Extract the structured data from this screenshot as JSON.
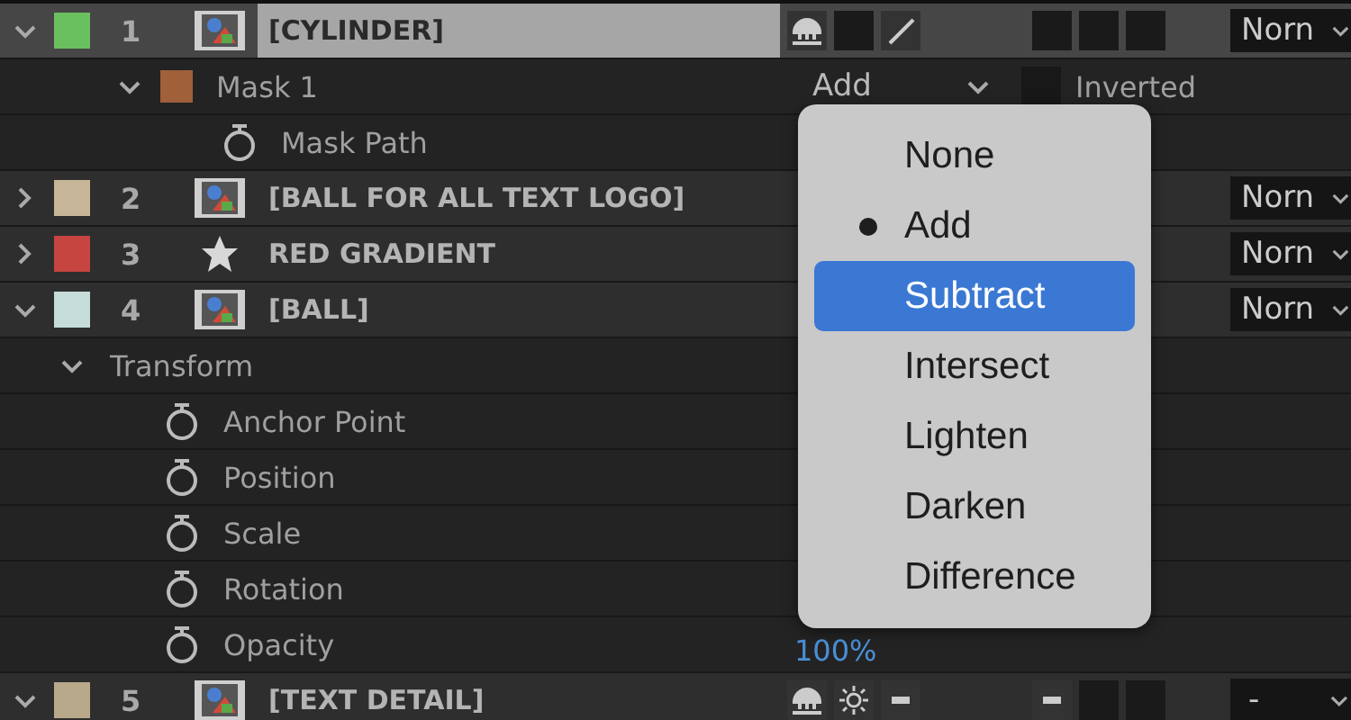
{
  "layers": [
    {
      "number": "1",
      "name": "[CYLINDER]",
      "color": "#6abf5e",
      "kind": "footage",
      "expanded": true,
      "selected": true,
      "switches": [
        {
          "kind": "puppet",
          "on": true
        },
        {
          "kind": "box",
          "on": false
        },
        {
          "kind": "slash",
          "on": true
        }
      ],
      "flags": [
        {
          "kind": "box",
          "on": false
        },
        {
          "kind": "box",
          "on": false
        },
        {
          "kind": "box",
          "on": false
        }
      ],
      "mode": "Norn",
      "children": [
        {
          "kind": "mask",
          "label": "Mask 1",
          "color": "#a0603a",
          "expanded": true,
          "mask_mode": "Add",
          "inverted_label": "Inverted",
          "inverted": false,
          "children": [
            {
              "kind": "property",
              "label": "Mask Path"
            }
          ]
        }
      ]
    },
    {
      "number": "2",
      "name": "[BALL FOR ALL TEXT LOGO]",
      "color": "#c7b798",
      "kind": "footage",
      "expanded": false,
      "selected": false,
      "mode": "Norn"
    },
    {
      "number": "3",
      "name": "RED GRADIENT",
      "color": "#c64541",
      "kind": "shape",
      "expanded": false,
      "selected": false,
      "mode": "Norn"
    },
    {
      "number": "4",
      "name": "[BALL]",
      "color": "#c5dcd9",
      "kind": "footage",
      "expanded": true,
      "selected": false,
      "mode": "Norn",
      "children": [
        {
          "kind": "group",
          "label": "Transform",
          "expanded": true,
          "children": [
            {
              "kind": "property",
              "label": "Anchor Point"
            },
            {
              "kind": "property",
              "label": "Position"
            },
            {
              "kind": "property",
              "label": "Scale"
            },
            {
              "kind": "property",
              "label": "Rotation"
            },
            {
              "kind": "property",
              "label": "Opacity",
              "value": "100%"
            }
          ]
        }
      ]
    },
    {
      "number": "5",
      "name": "[TEXT DETAIL]",
      "color": "#b8a98a",
      "kind": "footage",
      "expanded": true,
      "selected": false,
      "switches": [
        {
          "kind": "puppet",
          "on": true
        },
        {
          "kind": "sun",
          "on": true
        },
        {
          "kind": "dash",
          "on": true
        }
      ],
      "flags": [
        {
          "kind": "dash",
          "on": true
        },
        {
          "kind": "box",
          "on": false
        },
        {
          "kind": "box",
          "on": false
        }
      ],
      "mode": "-"
    }
  ],
  "menu": {
    "items": [
      {
        "label": "None",
        "checked": false,
        "selected": false
      },
      {
        "label": "Add",
        "checked": true,
        "selected": false
      },
      {
        "label": "Subtract",
        "checked": false,
        "selected": true
      },
      {
        "label": "Intersect",
        "checked": false,
        "selected": false
      },
      {
        "label": "Lighten",
        "checked": false,
        "selected": false
      },
      {
        "label": "Darken",
        "checked": false,
        "selected": false
      },
      {
        "label": "Difference",
        "checked": false,
        "selected": false
      }
    ]
  }
}
